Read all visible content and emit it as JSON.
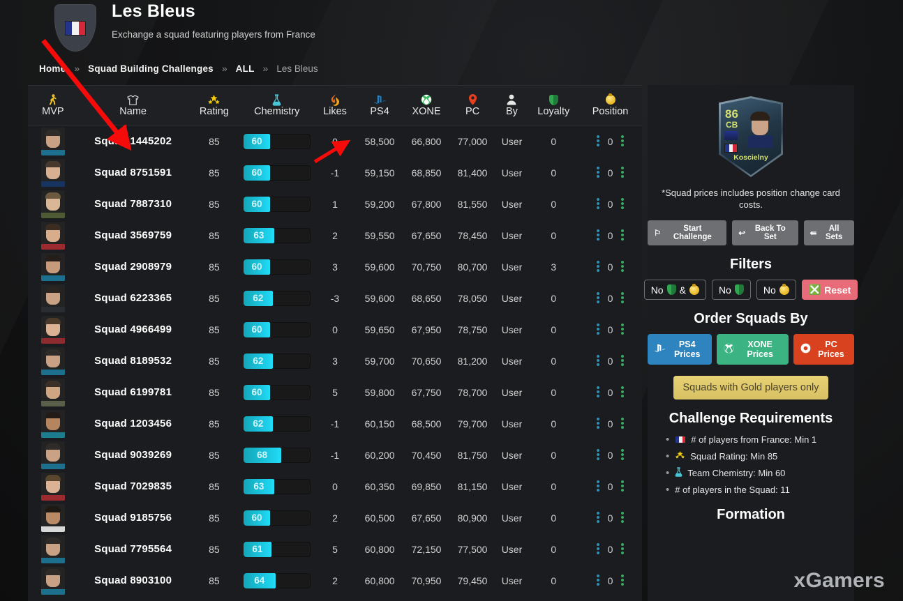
{
  "header": {
    "title": "Les Bleus",
    "subtitle": "Exchange a squad featuring players from France",
    "crest_icon": "france-flag-shield"
  },
  "breadcrumb": {
    "items": [
      {
        "label": "Home",
        "current": false
      },
      {
        "label": "Squad Building Challenges",
        "current": false
      },
      {
        "label": "ALL",
        "current": false
      },
      {
        "label": "Les Bleus",
        "current": true
      }
    ],
    "separator": "»"
  },
  "table": {
    "columns": [
      {
        "key": "mvp",
        "label": "MVP",
        "icon": "running-player-icon"
      },
      {
        "key": "name",
        "label": "Name",
        "icon": "jersey-icon"
      },
      {
        "key": "rating",
        "label": "Rating",
        "icon": "stars-icon"
      },
      {
        "key": "chemistry",
        "label": "Chemistry",
        "icon": "flask-icon"
      },
      {
        "key": "likes",
        "label": "Likes",
        "icon": "flame-icon"
      },
      {
        "key": "ps4",
        "label": "PS4",
        "icon": "playstation-icon"
      },
      {
        "key": "xone",
        "label": "XONE",
        "icon": "xbox-icon"
      },
      {
        "key": "pc",
        "label": "PC",
        "icon": "origin-icon"
      },
      {
        "key": "by",
        "label": "By",
        "icon": "user-icon"
      },
      {
        "key": "loyalty",
        "label": "Loyalty",
        "icon": "shield-icon"
      },
      {
        "key": "position",
        "label": "Position",
        "icon": "position-coin-icon"
      }
    ],
    "rows": [
      {
        "name": "Squad 1445202",
        "rating": "85",
        "chem": "60",
        "likes": "0",
        "ps4": "58,500",
        "xone": "66,800",
        "pc": "77,000",
        "by": "User",
        "loyalty": "0",
        "position": "0",
        "skin": "#c9a184",
        "hair": "#2e2b28",
        "kit": "#1d6f8e"
      },
      {
        "name": "Squad 8751591",
        "rating": "85",
        "chem": "60",
        "likes": "-1",
        "ps4": "59,150",
        "xone": "68,850",
        "pc": "81,400",
        "by": "User",
        "loyalty": "0",
        "position": "0",
        "skin": "#d6b091",
        "hair": "#46382c",
        "kit": "#17335f"
      },
      {
        "name": "Squad 7887310",
        "rating": "85",
        "chem": "60",
        "likes": "1",
        "ps4": "59,200",
        "xone": "67,800",
        "pc": "81,550",
        "by": "User",
        "loyalty": "0",
        "position": "0",
        "skin": "#d9b695",
        "hair": "#6b5a40",
        "kit": "#4d5a33"
      },
      {
        "name": "Squad 3569759",
        "rating": "85",
        "chem": "63",
        "likes": "2",
        "ps4": "59,550",
        "xone": "67,650",
        "pc": "78,450",
        "by": "User",
        "loyalty": "0",
        "position": "0",
        "skin": "#d8ad8b",
        "hair": "#3a2c20",
        "kit": "#9c2b30"
      },
      {
        "name": "Squad 2908979",
        "rating": "85",
        "chem": "60",
        "likes": "3",
        "ps4": "59,600",
        "xone": "70,750",
        "pc": "80,700",
        "by": "User",
        "loyalty": "3",
        "position": "0",
        "skin": "#c59b7c",
        "hair": "#241d18",
        "kit": "#1d6f8e"
      },
      {
        "name": "Squad 6223365",
        "rating": "85",
        "chem": "62",
        "likes": "-3",
        "ps4": "59,600",
        "xone": "68,650",
        "pc": "78,050",
        "by": "User",
        "loyalty": "0",
        "position": "0",
        "skin": "#c9a184",
        "hair": "#2b2522",
        "kit": "#2a2d31"
      },
      {
        "name": "Squad 4966499",
        "rating": "85",
        "chem": "60",
        "likes": "0",
        "ps4": "59,650",
        "xone": "67,950",
        "pc": "78,750",
        "by": "User",
        "loyalty": "0",
        "position": "0",
        "skin": "#dcb294",
        "hair": "#4b3a2a",
        "kit": "#8d2b2f"
      },
      {
        "name": "Squad 8189532",
        "rating": "85",
        "chem": "62",
        "likes": "3",
        "ps4": "59,700",
        "xone": "70,650",
        "pc": "81,200",
        "by": "User",
        "loyalty": "0",
        "position": "0",
        "skin": "#c9a184",
        "hair": "#2e2b28",
        "kit": "#1d6f8e"
      },
      {
        "name": "Squad 6199781",
        "rating": "85",
        "chem": "60",
        "likes": "5",
        "ps4": "59,800",
        "xone": "67,750",
        "pc": "78,700",
        "by": "User",
        "loyalty": "0",
        "position": "0",
        "skin": "#cfa683",
        "hair": "#3b3028",
        "kit": "#5a5f4a"
      },
      {
        "name": "Squad 1203456",
        "rating": "85",
        "chem": "62",
        "likes": "-1",
        "ps4": "60,150",
        "xone": "68,500",
        "pc": "79,700",
        "by": "User",
        "loyalty": "0",
        "position": "0",
        "skin": "#b4855f",
        "hair": "#231c16",
        "kit": "#1d7d8e"
      },
      {
        "name": "Squad 9039269",
        "rating": "85",
        "chem": "68",
        "likes": "-1",
        "ps4": "60,200",
        "xone": "70,450",
        "pc": "81,750",
        "by": "User",
        "loyalty": "0",
        "position": "0",
        "skin": "#c9a184",
        "hair": "#2e2b28",
        "kit": "#1d6f8e"
      },
      {
        "name": "Squad 7029835",
        "rating": "85",
        "chem": "63",
        "likes": "0",
        "ps4": "60,350",
        "xone": "69,850",
        "pc": "81,150",
        "by": "User",
        "loyalty": "0",
        "position": "0",
        "skin": "#dcb294",
        "hair": "#5a452f",
        "kit": "#9c2b30"
      },
      {
        "name": "Squad 9185756",
        "rating": "85",
        "chem": "60",
        "likes": "2",
        "ps4": "60,500",
        "xone": "67,650",
        "pc": "80,900",
        "by": "User",
        "loyalty": "0",
        "position": "0",
        "skin": "#b98a66",
        "hair": "#1f1913",
        "kit": "#d8d8d8"
      },
      {
        "name": "Squad 7795564",
        "rating": "85",
        "chem": "61",
        "likes": "5",
        "ps4": "60,800",
        "xone": "72,150",
        "pc": "77,500",
        "by": "User",
        "loyalty": "0",
        "position": "0",
        "skin": "#c9a184",
        "hair": "#2e2b28",
        "kit": "#1d6f8e"
      },
      {
        "name": "Squad 8903100",
        "rating": "85",
        "chem": "64",
        "likes": "2",
        "ps4": "60,800",
        "xone": "70,950",
        "pc": "79,450",
        "by": "User",
        "loyalty": "0",
        "position": "0",
        "skin": "#c9a184",
        "hair": "#2e2b28",
        "kit": "#1d6f8e"
      }
    ]
  },
  "sidebar": {
    "player_card": {
      "rating": "86",
      "position": "CB",
      "name": "Koscielny",
      "nation_icon": "france-flag-icon",
      "club_icon": "bordeaux-crest-icon"
    },
    "price_note": "*Squad prices includes position change card costs.",
    "actions": [
      {
        "label": "Start Challenge",
        "icon": "flag-checkered-icon"
      },
      {
        "label": "Back To Set",
        "icon": "arrow-left-icon"
      },
      {
        "label": "All Sets",
        "icon": "arrow-left-double-icon"
      }
    ],
    "filters_title": "Filters",
    "filters": [
      {
        "label": "No",
        "icons": [
          "shield-icon",
          "amp-text",
          "position-coin-icon"
        ],
        "name": "no-loyalty-and-position"
      },
      {
        "label": "No",
        "icons": [
          "shield-icon"
        ],
        "name": "no-loyalty"
      },
      {
        "label": "No",
        "icons": [
          "position-coin-icon"
        ],
        "name": "no-position"
      },
      {
        "label": "Reset",
        "icons": [
          "circle-x-icon"
        ],
        "name": "reset"
      }
    ],
    "order_title": "Order Squads By",
    "order_buttons": [
      {
        "label": "PS4 Prices",
        "icon": "playstation-icon",
        "color": "#2e84bf"
      },
      {
        "label": "XONE Prices",
        "icon": "xbox-icon",
        "color": "#3cb382"
      },
      {
        "label": "PC Prices",
        "icon": "origin-icon",
        "color": "#d9421f"
      }
    ],
    "gold_button": "Squads with Gold players only",
    "requirements_title": "Challenge Requirements",
    "requirements": [
      {
        "icon": "france-flag-icon",
        "text": "# of players from France: Min 1"
      },
      {
        "icon": "stars-icon",
        "text": "Squad Rating: Min 85"
      },
      {
        "icon": "flask-icon",
        "text": "Team Chemistry: Min 60"
      },
      {
        "icon": "none",
        "text": "# of players in the Squad: 11"
      }
    ],
    "formation_title": "Formation"
  },
  "watermark": "xGamers",
  "colors": {
    "panel": "#1a1c1f",
    "chem_fill_start": "#14a6b8",
    "chem_fill_end": "#22dff7",
    "accent_gold": "#e6d173",
    "reset_red": "#e76b78",
    "annotation_red": "#f60b0b"
  }
}
